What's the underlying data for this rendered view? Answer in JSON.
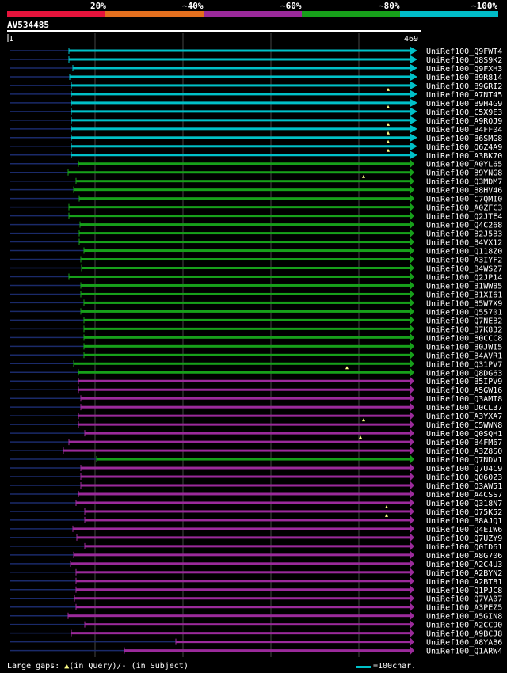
{
  "legend": [
    {
      "label": "20%",
      "color": "#e6143c"
    },
    {
      "label": "~40%",
      "color": "#e36f1e"
    },
    {
      "label": "~60%",
      "color": "#9b2a9b"
    },
    {
      "label": "~80%",
      "color": "#17a01a"
    },
    {
      "label": "~100%",
      "color": "#00bcc8"
    }
  ],
  "query": {
    "id": "AV534485",
    "start": "1",
    "end": "469"
  },
  "footer": {
    "large_gaps_label": "Large gaps:",
    "in_query": "(in Query)/",
    "dash": "-",
    "in_subject": "(in Subject)",
    "scale_label": "=100char."
  },
  "hits": [
    {
      "id": "UniRef100_Q9FWT4",
      "color": "cyan",
      "start": 87,
      "marker": null
    },
    {
      "id": "UniRef100_Q8S9K2",
      "color": "cyan",
      "start": 87,
      "marker": null
    },
    {
      "id": "UniRef100_Q9FXH3",
      "color": "cyan",
      "start": 92,
      "marker": null
    },
    {
      "id": "UniRef100_B9R814",
      "color": "cyan",
      "start": 88,
      "marker": null
    },
    {
      "id": "UniRef100_B9GRI2",
      "color": "cyan",
      "start": 90,
      "marker": null
    },
    {
      "id": "UniRef100_A7NT45",
      "color": "cyan",
      "start": 90,
      "marker": 490
    },
    {
      "id": "UniRef100_B9H4G9",
      "color": "cyan",
      "start": 90,
      "marker": null
    },
    {
      "id": "UniRef100_C5X9E3",
      "color": "cyan",
      "start": 90,
      "marker": 490
    },
    {
      "id": "UniRef100_A9RQJ9",
      "color": "cyan",
      "start": 90,
      "marker": null
    },
    {
      "id": "UniRef100_B4FF04",
      "color": "cyan",
      "start": 90,
      "marker": 490
    },
    {
      "id": "UniRef100_B6SMG8",
      "color": "cyan",
      "start": 90,
      "marker": 490
    },
    {
      "id": "UniRef100_Q6Z4A9",
      "color": "cyan",
      "start": 90,
      "marker": 490
    },
    {
      "id": "UniRef100_A3BK70",
      "color": "cyan",
      "start": 90,
      "marker": 490
    },
    {
      "id": "UniRef100_A0YL65",
      "color": "green",
      "start": 99,
      "marker": null
    },
    {
      "id": "UniRef100_B9YNG8",
      "color": "green",
      "start": 86,
      "marker": null
    },
    {
      "id": "UniRef100_Q3MDM7",
      "color": "green",
      "start": 96,
      "marker": 459
    },
    {
      "id": "UniRef100_B8HV46",
      "color": "green",
      "start": 93,
      "marker": null
    },
    {
      "id": "UniRef100_C7QMI0",
      "color": "green",
      "start": 100,
      "marker": null
    },
    {
      "id": "UniRef100_A0ZFC3",
      "color": "green",
      "start": 87,
      "marker": null
    },
    {
      "id": "UniRef100_Q2JTE4",
      "color": "green",
      "start": 87,
      "marker": null
    },
    {
      "id": "UniRef100_Q4C268",
      "color": "green",
      "start": 101,
      "marker": null
    },
    {
      "id": "UniRef100_B2J5B3",
      "color": "green",
      "start": 100,
      "marker": null
    },
    {
      "id": "UniRef100_B4VX12",
      "color": "green",
      "start": 100,
      "marker": null
    },
    {
      "id": "UniRef100_Q118Z0",
      "color": "green",
      "start": 106,
      "marker": null
    },
    {
      "id": "UniRef100_A3IYF2",
      "color": "green",
      "start": 102,
      "marker": null
    },
    {
      "id": "UniRef100_B4WS27",
      "color": "green",
      "start": 103,
      "marker": null
    },
    {
      "id": "UniRef100_Q2JP14",
      "color": "green",
      "start": 87,
      "marker": null
    },
    {
      "id": "UniRef100_B1WW85",
      "color": "green",
      "start": 102,
      "marker": null
    },
    {
      "id": "UniRef100_B1XI61",
      "color": "green",
      "start": 102,
      "marker": null
    },
    {
      "id": "UniRef100_B5W7X9",
      "color": "green",
      "start": 106,
      "marker": null
    },
    {
      "id": "UniRef100_Q55701",
      "color": "green",
      "start": 102,
      "marker": null
    },
    {
      "id": "UniRef100_Q7NEB2",
      "color": "green",
      "start": 106,
      "marker": null
    },
    {
      "id": "UniRef100_B7K832",
      "color": "green",
      "start": 106,
      "marker": null
    },
    {
      "id": "UniRef100_B0CCC8",
      "color": "green",
      "start": 106,
      "marker": null
    },
    {
      "id": "UniRef100_B0JWI5",
      "color": "green",
      "start": 106,
      "marker": null
    },
    {
      "id": "UniRef100_B4AVR1",
      "color": "green",
      "start": 106,
      "marker": null
    },
    {
      "id": "UniRef100_Q31PV7",
      "color": "green",
      "start": 93,
      "marker": null
    },
    {
      "id": "UniRef100_Q8DG63",
      "color": "green",
      "start": 99,
      "marker": 438
    },
    {
      "id": "UniRef100_B5IPV9",
      "color": "purple",
      "start": 99,
      "marker": null
    },
    {
      "id": "UniRef100_A5GW16",
      "color": "purple",
      "start": 99,
      "marker": null
    },
    {
      "id": "UniRef100_Q3AMT8",
      "color": "purple",
      "start": 102,
      "marker": null
    },
    {
      "id": "UniRef100_D0CL37",
      "color": "purple",
      "start": 102,
      "marker": null
    },
    {
      "id": "UniRef100_A3YXA7",
      "color": "purple",
      "start": 99,
      "marker": null
    },
    {
      "id": "UniRef100_C5WWN8",
      "color": "purple",
      "start": 99,
      "marker": 459
    },
    {
      "id": "UniRef100_Q0SQH1",
      "color": "purple",
      "start": 107,
      "marker": null
    },
    {
      "id": "UniRef100_B4FM67",
      "color": "purple",
      "start": 87,
      "marker": 455
    },
    {
      "id": "UniRef100_A3Z8S0",
      "color": "purple",
      "start": 80,
      "marker": null
    },
    {
      "id": "UniRef100_Q7NDV1",
      "color": "green",
      "start": 122,
      "marker": null
    },
    {
      "id": "UniRef100_Q7U4C9",
      "color": "purple",
      "start": 102,
      "marker": null
    },
    {
      "id": "UniRef100_Q060Z3",
      "color": "purple",
      "start": 102,
      "marker": null
    },
    {
      "id": "UniRef100_Q3AW51",
      "color": "purple",
      "start": 102,
      "marker": null
    },
    {
      "id": "UniRef100_A4CSS7",
      "color": "purple",
      "start": 99,
      "marker": null
    },
    {
      "id": "UniRef100_Q318N7",
      "color": "purple",
      "start": 96,
      "marker": null
    },
    {
      "id": "UniRef100_Q75K52",
      "color": "purple",
      "start": 107,
      "marker": 488
    },
    {
      "id": "UniRef100_B8AJQ1",
      "color": "purple",
      "start": 107,
      "marker": 488
    },
    {
      "id": "UniRef100_Q4EIW6",
      "color": "purple",
      "start": 92,
      "marker": null
    },
    {
      "id": "UniRef100_Q7UZY9",
      "color": "purple",
      "start": 97,
      "marker": null
    },
    {
      "id": "UniRef100_Q0ID61",
      "color": "purple",
      "start": 107,
      "marker": null
    },
    {
      "id": "UniRef100_A8G706",
      "color": "purple",
      "start": 93,
      "marker": null
    },
    {
      "id": "UniRef100_A2C4U3",
      "color": "purple",
      "start": 89,
      "marker": null
    },
    {
      "id": "UniRef100_A2BYN2",
      "color": "purple",
      "start": 96,
      "marker": null
    },
    {
      "id": "UniRef100_A2BT81",
      "color": "purple",
      "start": 96,
      "marker": null
    },
    {
      "id": "UniRef100_Q1PJC8",
      "color": "purple",
      "start": 96,
      "marker": null
    },
    {
      "id": "UniRef100_Q7VA07",
      "color": "purple",
      "start": 94,
      "marker": null
    },
    {
      "id": "UniRef100_A3PEZ5",
      "color": "purple",
      "start": 96,
      "marker": null
    },
    {
      "id": "UniRef100_A5GIN8",
      "color": "purple",
      "start": 86,
      "marker": null
    },
    {
      "id": "UniRef100_A2CC90",
      "color": "purple",
      "start": 107,
      "marker": null
    },
    {
      "id": "UniRef100_A9BCJ8",
      "color": "purple",
      "start": 90,
      "marker": null
    },
    {
      "id": "UniRef100_A8YAB6",
      "color": "purple",
      "start": 222,
      "marker": null
    },
    {
      "id": "UniRef100_Q1ARW4",
      "color": "purple",
      "start": 157,
      "marker": null
    }
  ],
  "colors": {
    "cyan": "#00c0c8",
    "green": "#17a01a",
    "purple": "#9b2a9b",
    "left_line": "#1a2a6a",
    "marker": "#ffff88",
    "grid": "#444444"
  }
}
